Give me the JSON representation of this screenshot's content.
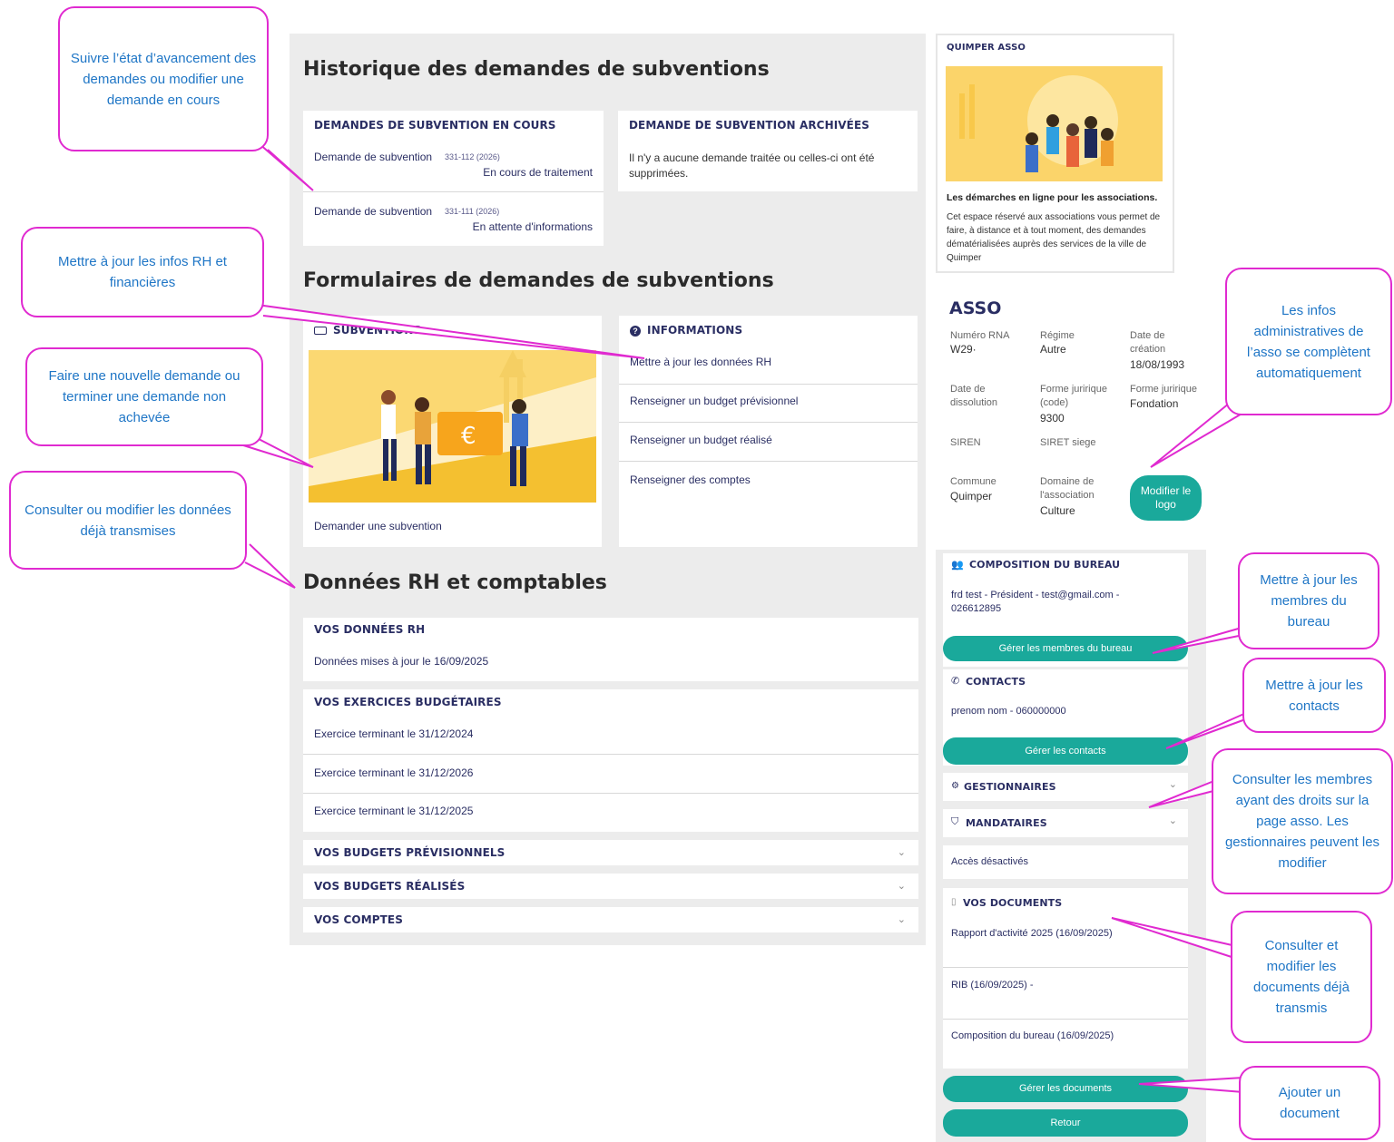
{
  "main": {
    "historique_title": "Historique des demandes de subventions",
    "en_cours": {
      "title": "DEMANDES DE SUBVENTION EN COURS",
      "items": [
        {
          "label": "Demande de subvention",
          "ref": "331-112 (2026)",
          "status": "En cours de traitement"
        },
        {
          "label": "Demande de subvention",
          "ref": "331-111 (2026)",
          "status": "En attente d'informations"
        }
      ]
    },
    "archivees": {
      "title": "DEMANDE DE SUBVENTION ARCHIVÉES",
      "text": "Il n'y a aucune demande traitée ou celles-ci ont été supprimées."
    },
    "formulaires_title": "Formulaires de demandes de subventions",
    "subventions": {
      "title": "SUBVENTIONS",
      "link": "Demander une subvention"
    },
    "informations": {
      "title": "INFORMATIONS",
      "links": [
        "Mettre à jour les données RH",
        "Renseigner un budget prévisionnel",
        "Renseigner un budget réalisé",
        "Renseigner des comptes"
      ]
    },
    "donnees_title": "Données RH et comptables",
    "rh": {
      "title": "VOS DONNÉES RH",
      "text": "Données mises à jour le 16/09/2025"
    },
    "exercices": {
      "title": "VOS EXERCICES BUDGÉTAIRES",
      "items": [
        "Exercice terminant le 31/12/2024",
        "Exercice terminant le 31/12/2026",
        "Exercice terminant le 31/12/2025"
      ]
    },
    "collapsed": [
      "VOS BUDGETS PRÉVISIONNELS",
      "VOS BUDGETS RÉALISÉS",
      "VOS COMPTES"
    ]
  },
  "sidebar": {
    "quimper": {
      "title": "QUIMPER ASSO",
      "subtitle": "Les démarches en ligne pour les associations.",
      "text": "Cet espace réservé aux associations vous permet de faire, à distance et à tout moment, des demandes dématérialisées auprès des services de la ville de Quimper"
    },
    "asso": {
      "title": "ASSO",
      "rna_label": "Numéro RNA",
      "rna_value": "W29·",
      "regime_label": "Régime",
      "regime_value": "Autre",
      "creation_label": "Date de création",
      "creation_value": "18/08/1993",
      "dissolution_label": "Date de dissolution",
      "forme_code_label": "Forme juririque (code)",
      "forme_code_value": "9300",
      "forme_label": "Forme juririque",
      "forme_value": "Fondation",
      "siren_label": "SIREN",
      "siret_label": "SIRET siege",
      "commune_label": "Commune",
      "commune_value": "Quimper",
      "domaine_label": "Domaine de l'association",
      "domaine_value": "Culture",
      "logo_button": "Modifier le logo"
    },
    "bureau": {
      "title": "COMPOSITION DU BUREAU",
      "text": "frd test - Président - test@gmail.com - 026612895",
      "button": "Gérer les membres du bureau"
    },
    "contacts": {
      "title": "CONTACTS",
      "text": "prenom nom - 060000000",
      "button": "Gérer les contacts"
    },
    "gestionnaires": {
      "title": "GESTIONNAIRES"
    },
    "mandataires": {
      "title": "MANDATAIRES",
      "text": "Accès désactivés"
    },
    "documents": {
      "title": "VOS DOCUMENTS",
      "items": [
        "Rapport d'activité 2025 (16/09/2025)",
        "RIB (16/09/2025) -",
        "Composition du bureau (16/09/2025)"
      ],
      "button": "Gérer les documents"
    },
    "retour": "Retour"
  },
  "callouts": {
    "suivre": "Suivre l’état d’avancement des demandes ou modifier une demande en cours",
    "rh": "Mettre à jour les infos RH et financières",
    "nouvelle": "Faire une nouvelle demande ou terminer une demande non achevée",
    "consulter": "Consulter ou modifier les données déjà transmises",
    "admin": "Les infos administratives de l’asso se complètent automatiquement",
    "bureau": "Mettre à jour les membres du bureau",
    "contacts": "Mettre à jour les contacts",
    "membres": "Consulter les membres ayant des droits sur la page asso. Les gestionnaires peuvent les modifier",
    "documents": "Consulter et modifier les documents déjà transmis",
    "ajouter": "Ajouter un document"
  },
  "colors": {
    "accent": "#1aa99b",
    "callout": "#e02ad0",
    "callout_text": "#1f76c6",
    "title_blue": "#2a2e63",
    "illustration_yellow": "#f7c948"
  },
  "icons": [
    "money-icon",
    "info-icon",
    "group-icon",
    "phone-icon",
    "gear-icon",
    "shield-icon",
    "document-icon",
    "chevron-down-icon"
  ]
}
